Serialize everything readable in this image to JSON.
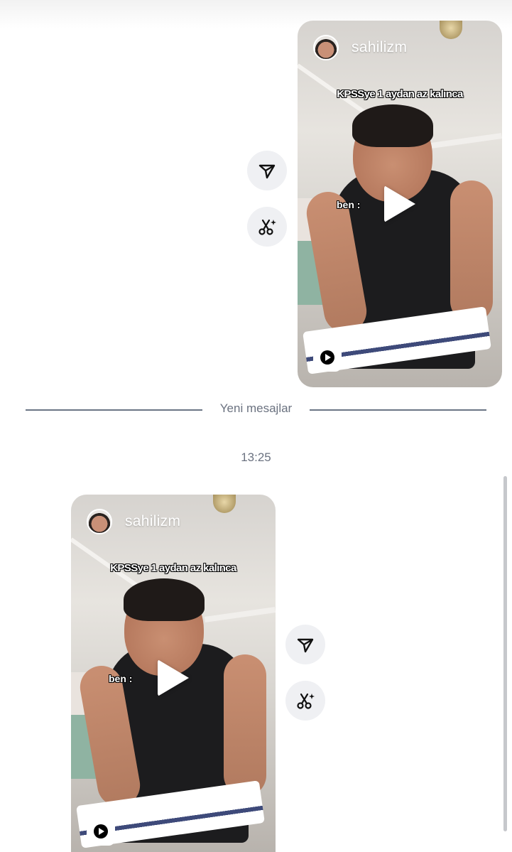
{
  "messages": [
    {
      "username": "sahilizm",
      "caption_top": "KPSSye 1 aydan az kalınca",
      "caption_side": "ben :"
    },
    {
      "username": "sahilizm",
      "caption_top": "KPSSye 1 aydan az kalınca",
      "caption_side": "ben :"
    }
  ],
  "divider_label": "Yeni mesajlar",
  "timestamp": "13:25",
  "icons": {
    "share": "send-icon",
    "remix": "scissors-sparkle-icon",
    "reel": "play-icon"
  }
}
